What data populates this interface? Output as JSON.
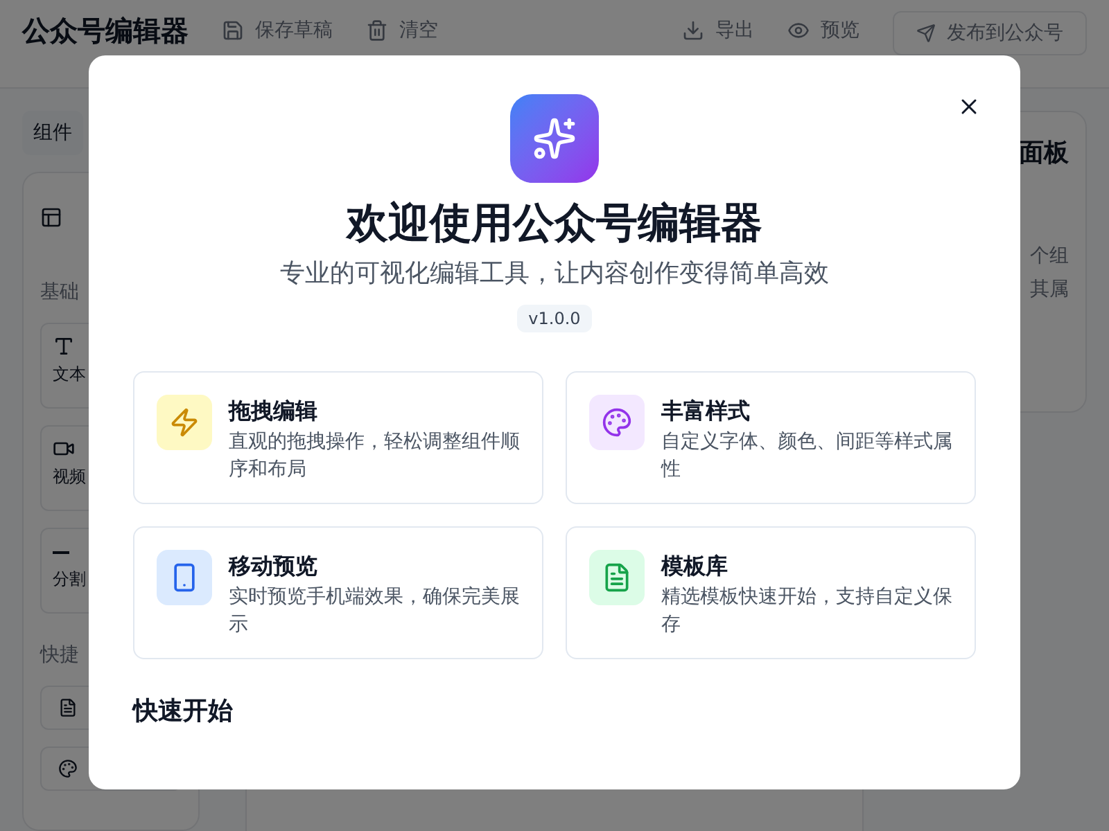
{
  "header": {
    "title": "公众号编辑器",
    "actions": [
      {
        "kind": "save",
        "label": "保存草稿"
      },
      {
        "kind": "clear",
        "label": "清空"
      },
      {
        "kind": "export",
        "label": "导出"
      },
      {
        "kind": "preview",
        "label": "预览"
      }
    ],
    "publish": "发布到公众号"
  },
  "left_panel": {
    "tab": "组件",
    "section_1": "基础",
    "items": [
      {
        "kind": "text",
        "label": "文本"
      },
      {
        "kind": "video",
        "label": "视频"
      },
      {
        "kind": "divider",
        "label": "分割"
      }
    ],
    "section_2": "快捷",
    "quick_items": [
      {
        "kind": "file"
      },
      {
        "kind": "palette"
      }
    ]
  },
  "right_panel": {
    "title": "面板",
    "lines": [
      "个组",
      "其属"
    ]
  },
  "dialog": {
    "title": "欢迎使用公众号编辑器",
    "subtitle": "专业的可视化编辑工具，让内容创作变得简单高效",
    "version": "v1.0.0",
    "features": [
      {
        "kind": "zap",
        "color": "#ca8a04",
        "title": "拖拽编辑",
        "description": "直观的拖拽操作，轻松调整组件顺序和布局"
      },
      {
        "kind": "palette",
        "color": "#9333ea",
        "title": "丰富样式",
        "description": "自定义字体、颜色、间距等样式属性"
      },
      {
        "kind": "phone",
        "color": "#2563eb",
        "title": "移动预览",
        "description": "实时预览手机端效果，确保完美展示"
      },
      {
        "kind": "file",
        "color": "#16a34a",
        "title": "模板库",
        "description": "精选模板快速开始，支持自定义保存"
      }
    ],
    "section_title": "快速开始"
  }
}
